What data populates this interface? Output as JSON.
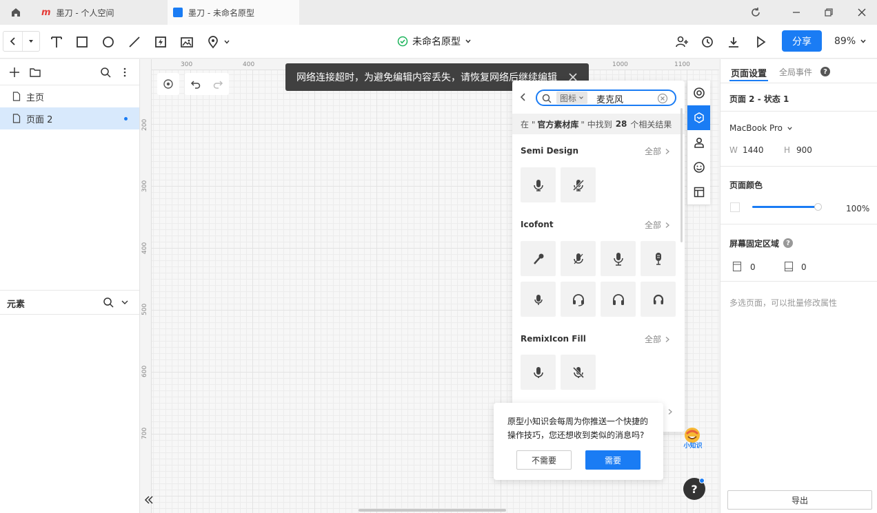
{
  "tabs": [
    {
      "title": "墨刀 - 个人空间",
      "active": false
    },
    {
      "title": "墨刀 - 未命名原型",
      "active": true
    }
  ],
  "toolbar": {
    "project_title": "未命名原型",
    "share_label": "分享",
    "zoom": "89%"
  },
  "left": {
    "pages": [
      {
        "label": "主页",
        "selected": false
      },
      {
        "label": "页面 2",
        "selected": true
      }
    ],
    "elements_title": "元素"
  },
  "ruler": {
    "top": [
      "300",
      "400",
      "1000",
      "1100"
    ],
    "left": [
      "200",
      "300",
      "400",
      "500",
      "600",
      "700"
    ]
  },
  "toast": {
    "message": "网络连接超时，为避免编辑内容丢失，请恢复网络后继续编辑"
  },
  "icon_panel": {
    "search_scope": "图标",
    "search_query": "麦克风",
    "result_prefix": "在 \"",
    "result_lib": "官方素材库",
    "result_mid": "\" 中找到",
    "result_count": "28",
    "result_suffix": "个相关结果",
    "all_label": "全部",
    "sections": [
      {
        "name": "Semi Design",
        "icons": [
          "microphone-icon",
          "microphone-off-icon"
        ]
      },
      {
        "name": "Icofont",
        "icons": [
          "microphone-handheld-icon",
          "microphone-mute-icon",
          "microphone-stand-icon",
          "microphone-studio-icon",
          "microphone-alt-icon",
          "headset-icon",
          "headphones-icon",
          "headphones-alt-icon"
        ]
      },
      {
        "name": "RemixIcon Fill",
        "icons": [
          "microphone-fill-icon",
          "microphone-off-fill-icon"
        ]
      }
    ]
  },
  "tip": {
    "line1": "原型小知识会每周为你推送一个快捷的",
    "line2": "操作技巧，您还想收到类似的消息吗?",
    "decline": "不需要",
    "accept": "需要",
    "badge": "小知识"
  },
  "right": {
    "tab_page_settings": "页面设置",
    "tab_global_events": "全局事件",
    "state_title": "页面 2 - 状态 1",
    "device": "MacBook Pro",
    "w_label": "W",
    "w_value": "1440",
    "h_label": "H",
    "h_value": "900",
    "page_color_title": "页面颜色",
    "opacity": "100%",
    "fixed_area_title": "屏幕固定区域",
    "fixed_top": "0",
    "fixed_bottom": "0",
    "multi_select_hint": "多选页面，可以批量修改属性",
    "export_label": "导出"
  },
  "colors": {
    "accent": "#1a7cf4",
    "selected_bg": "#d8e9fc",
    "toast_bg": "#404040"
  }
}
